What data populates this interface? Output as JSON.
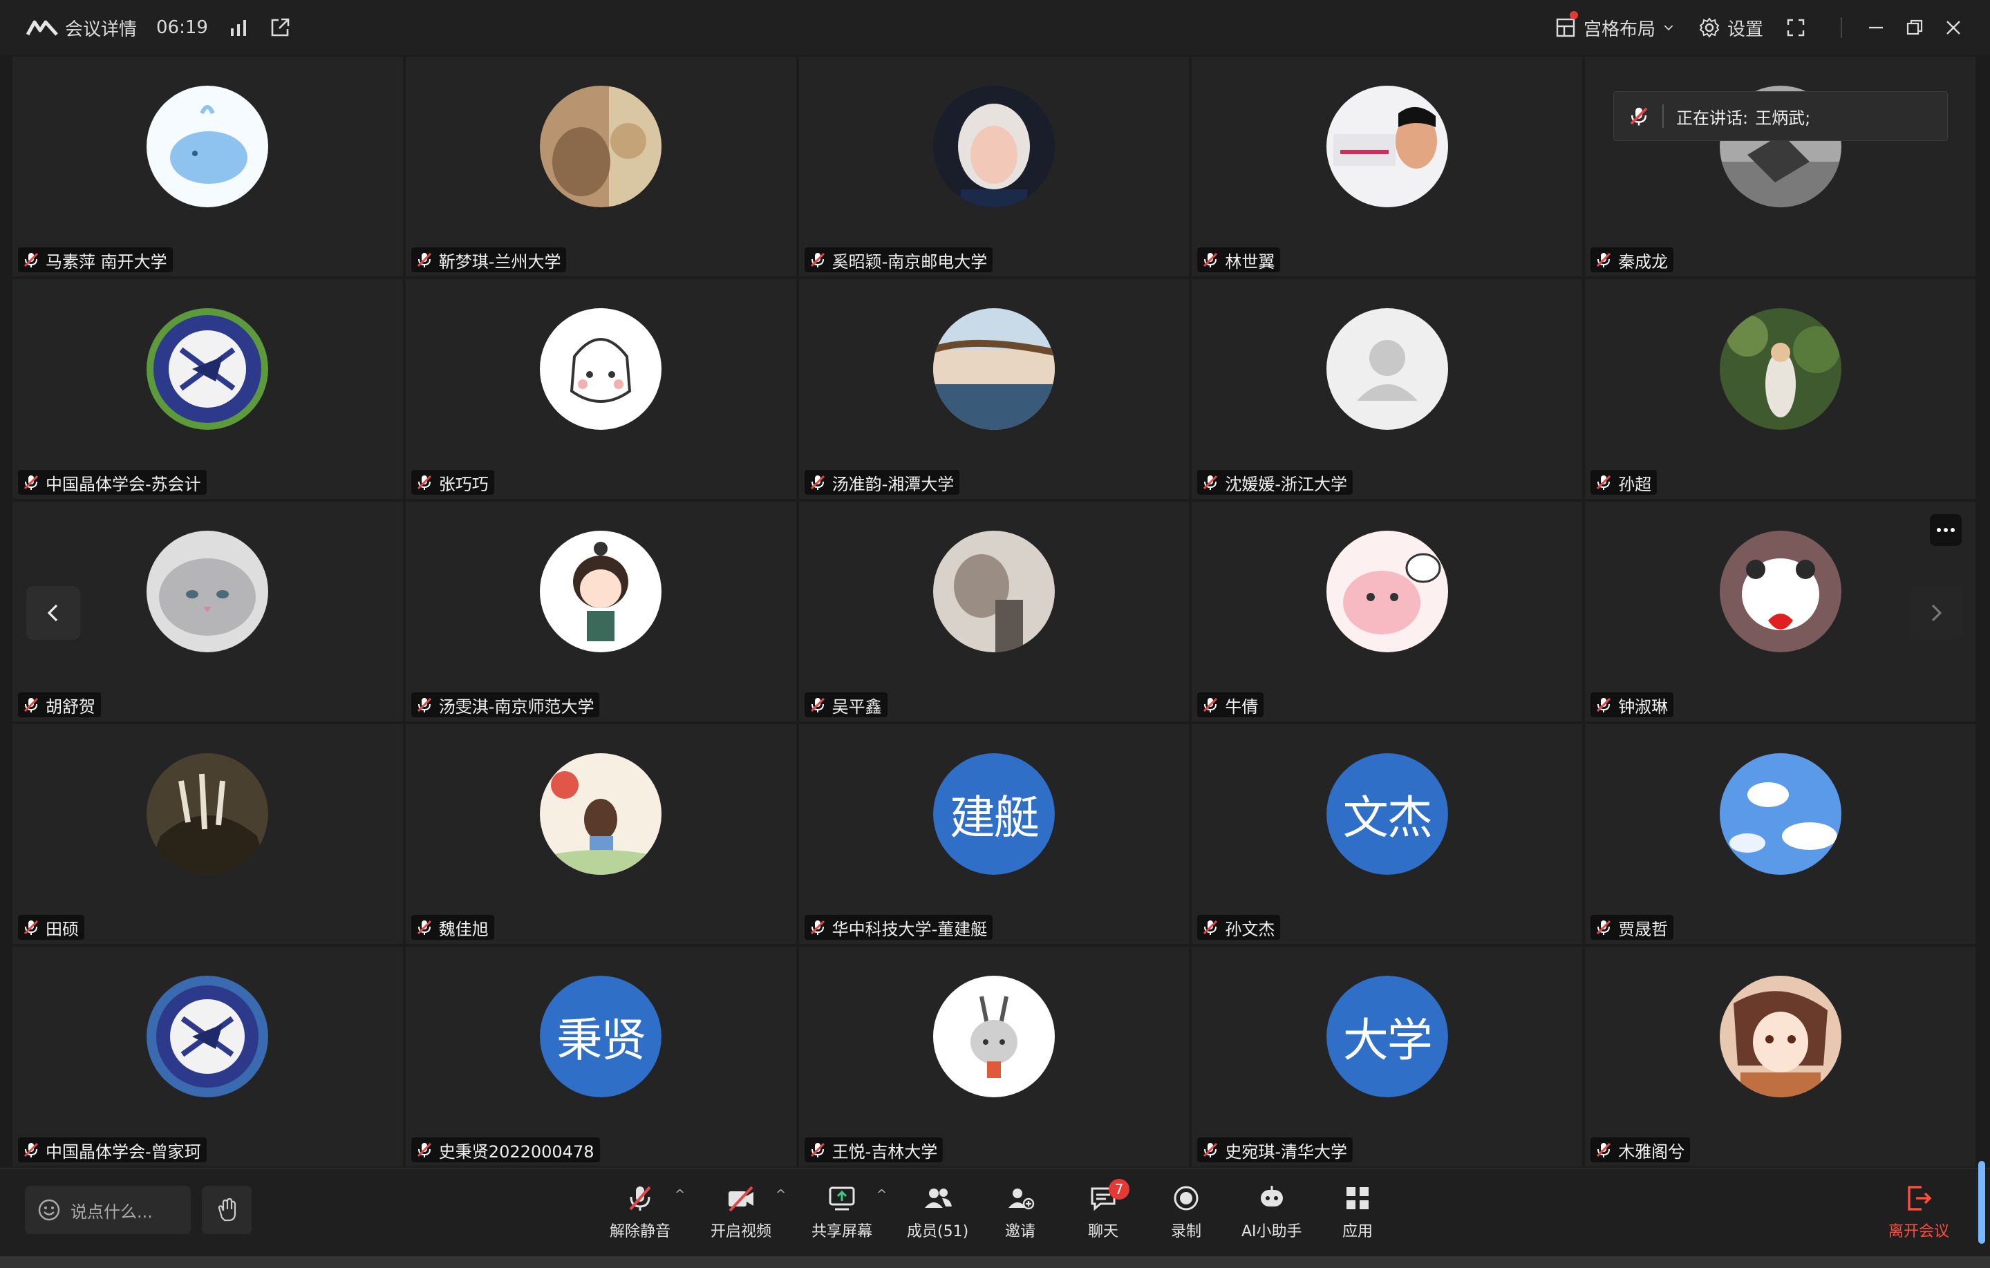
{
  "titlebar": {
    "meeting_info": "会议详情",
    "timer": "06:19",
    "layout_label": "宫格布局",
    "settings_label": "设置"
  },
  "speaking": {
    "label": "正在讲话:",
    "name": "王炳武;"
  },
  "participants": [
    {
      "name": "马素萍 南开大学"
    },
    {
      "name": "靳梦琪-兰州大学"
    },
    {
      "name": "奚昭颖-南京邮电大学"
    },
    {
      "name": "林世翼"
    },
    {
      "name": "秦成龙"
    },
    {
      "name": "中国晶体学会-苏会计"
    },
    {
      "name": "张巧巧"
    },
    {
      "name": "汤准韵-湘潭大学"
    },
    {
      "name": "沈媛媛-浙江大学"
    },
    {
      "name": "孙超"
    },
    {
      "name": "胡舒贺"
    },
    {
      "name": "汤雯淇-南京师范大学"
    },
    {
      "name": "吴平鑫"
    },
    {
      "name": "牛倩"
    },
    {
      "name": "钟淑琳"
    },
    {
      "name": "田硕"
    },
    {
      "name": "魏佳旭"
    },
    {
      "name": "华中科技大学-董建艇",
      "text_avatar": "建艇"
    },
    {
      "name": "孙文杰",
      "text_avatar": "文杰"
    },
    {
      "name": "贾晟哲"
    },
    {
      "name": "中国晶体学会-曾家珂"
    },
    {
      "name": "史秉贤2022000478",
      "text_avatar": "秉贤"
    },
    {
      "name": "王悦-吉林大学"
    },
    {
      "name": "史宛琪-清华大学",
      "text_avatar": "大学"
    },
    {
      "name": "木雅阁兮"
    }
  ],
  "toolbar": {
    "chat_placeholder": "说点什么...",
    "unmute": "解除静音",
    "start_video": "开启视频",
    "share_screen": "共享屏幕",
    "members": "成员(51)",
    "invite": "邀请",
    "chat": "聊天",
    "chat_badge": "7",
    "record": "录制",
    "ai_assistant": "AI小助手",
    "apps": "应用",
    "leave": "离开会议"
  },
  "colors": {
    "text_avatar_bg": "#2f6fc8",
    "muted_icon": "#e04848",
    "leave": "#ff4d3d",
    "badge": "#e53935"
  }
}
